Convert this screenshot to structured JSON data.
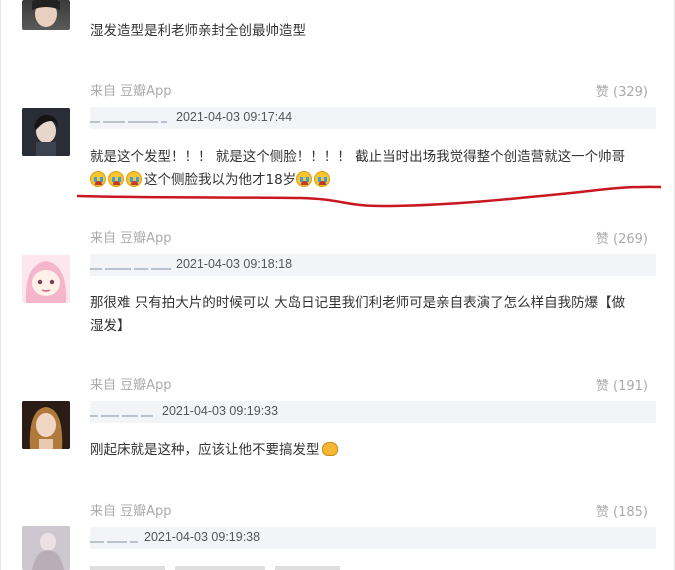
{
  "comments": [
    {
      "text": "湿发造型是利老师亲封全创最帅造型",
      "source": "来自 豆瓣App",
      "likes": "赞 (329)"
    },
    {
      "time": "2021-04-03 09:17:44",
      "text_line1": "就是这个发型！！！ 就是这个侧脸！！！！ 截止当时出场我觉得整个创造营就这一个帅哥",
      "text_line2_after_emoji": "这个侧脸我以为他才18岁",
      "source": "来自 豆瓣App",
      "likes": "赞 (269)"
    },
    {
      "time": "2021-04-03 09:18:18",
      "text_line1": "那很难 只有拍大片的时候可以 大岛日记里我们利老师可是亲自表演了怎么样自我防爆【做",
      "text_line2": "湿发】",
      "source": "来自 豆瓣App",
      "likes": "赞 (191)"
    },
    {
      "time": "2021-04-03 09:19:33",
      "text": "刚起床就是这种，应该让他不要搞发型",
      "source": "来自 豆瓣App",
      "likes": "赞 (185)"
    },
    {
      "time": "2021-04-03 09:19:38"
    }
  ],
  "colors": {
    "annotation_underline": "#c8171e",
    "meta_bar": "#f2f4f7"
  },
  "icons": [
    "cry-emoji-icon",
    "fist-emoji-icon"
  ]
}
